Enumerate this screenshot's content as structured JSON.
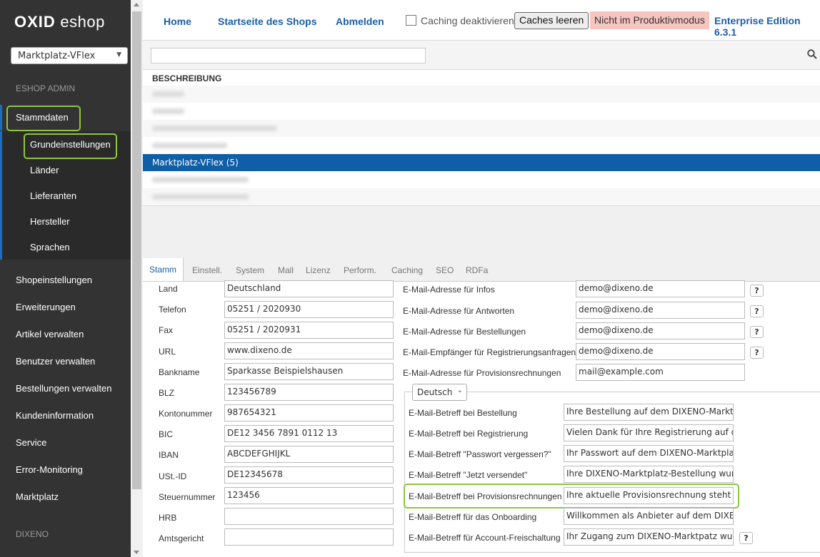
{
  "sidebar": {
    "logo": "OXID",
    "logo_suffix": "eshop",
    "shop_select": "Marktplatz-VFlex",
    "section_admin": "ESHOP ADMIN",
    "stammdaten": "Stammdaten",
    "sub_items": [
      "Grundeinstellungen",
      "Länder",
      "Lieferanten",
      "Hersteller",
      "Sprachen"
    ],
    "items": [
      "Shopeinstellungen",
      "Erweiterungen",
      "Artikel verwalten",
      "Benutzer verwalten",
      "Bestellungen verwalten",
      "Kundeninformation",
      "Service",
      "Error-Monitoring",
      "Marktplatz"
    ],
    "section_dixeno": "DIXENO"
  },
  "topbar": {
    "home": "Home",
    "shop_start": "Startseite des Shops",
    "logout": "Abmelden",
    "caching_label": "Caching deaktivieren",
    "clear_caches": "Caches leeren",
    "mode_badge": "Nicht im Produktivmodus",
    "edition": "Enterprise Edition 6.3.1"
  },
  "list": {
    "header": "BESCHREIBUNG",
    "selected": "Marktplatz-VFlex (5)"
  },
  "tabs": [
    "Stamm",
    "Einstell.",
    "System",
    "Mall",
    "Lizenz",
    "Perform.",
    "Caching",
    "SEO",
    "RDFa"
  ],
  "left_form": [
    {
      "label": "Land",
      "value": "Deutschland"
    },
    {
      "label": "Telefon",
      "value": "05251 / 2020930"
    },
    {
      "label": "Fax",
      "value": "05251 / 2020931"
    },
    {
      "label": "URL",
      "value": "www.dixeno.de"
    },
    {
      "label": "Bankname",
      "value": "Sparkasse Beispielshausen"
    },
    {
      "label": "BLZ",
      "value": "123456789"
    },
    {
      "label": "Kontonummer",
      "value": "987654321"
    },
    {
      "label": "BIC",
      "value": "DE12 3456 7891 0112 13"
    },
    {
      "label": "IBAN",
      "value": "ABCDEFGHIJKL"
    },
    {
      "label": "USt.-ID",
      "value": "DE12345678"
    },
    {
      "label": "Steuernummer",
      "value": "123456"
    },
    {
      "label": "HRB",
      "value": ""
    },
    {
      "label": "Amtsgericht",
      "value": ""
    }
  ],
  "right_emails": [
    {
      "label": "E-Mail-Adresse für Infos",
      "value": "demo@dixeno.de"
    },
    {
      "label": "E-Mail-Adresse für Antworten",
      "value": "demo@dixeno.de"
    },
    {
      "label": "E-Mail-Adresse für Bestellungen",
      "value": "demo@dixeno.de"
    },
    {
      "label": "E-Mail-Empfänger für Registrierungsanfragen",
      "value": "demo@dixeno.de"
    },
    {
      "label": "E-Mail-Adresse für Provisionsrechnungen",
      "value": "mail@example.com"
    }
  ],
  "language_select": "Deutsch",
  "subjects": [
    {
      "label": "E-Mail-Betreff bei Bestellung",
      "value": "Ihre Bestellung auf dem DIXENO-Marktplatz"
    },
    {
      "label": "E-Mail-Betreff bei Registrierung",
      "value": "Vielen Dank für Ihre Registrierung auf dem"
    },
    {
      "label": "E-Mail-Betreff \"Passwort vergessen?\"",
      "value": "Ihr Passwort auf dem DIXENO-Marktplatz"
    },
    {
      "label": "E-Mail-Betreff \"Jetzt versendet\"",
      "value": "Ihre DIXENO-Marktplatz-Bestellung wurde"
    },
    {
      "label": "E-Mail-Betreff bei Provisionsrechnungen",
      "value": "Ihre aktuelle Provisionsrechnung steht bereit"
    },
    {
      "label": "E-Mail-Betreff für das Onboarding",
      "value": "Willkommen als Anbieter auf dem DIXENO"
    },
    {
      "label": "E-Mail-Betreff für Account-Freischaltung",
      "value": "Ihr Zugang zum DIXENO-Marktpatz wurde"
    }
  ],
  "help_label": "?",
  "colors": {
    "accent": "#1b5ea8",
    "highlight": "#8dc63f",
    "sidebar": "#333333",
    "selected_row": "#0f5ea8",
    "badge": "#f6c5c0"
  }
}
